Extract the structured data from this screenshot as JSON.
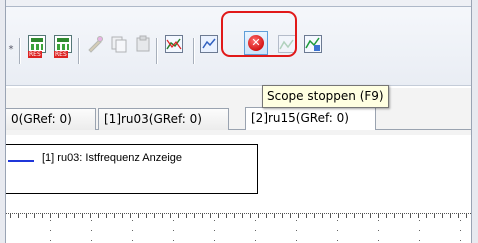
{
  "toolbar": {
    "stop_button": {
      "label": "Scope stoppen (F9)"
    }
  },
  "tooltip": {
    "text": "Scope stoppen (F9)"
  },
  "tabs": [
    {
      "label": "0(GRef: 0)"
    },
    {
      "label": "[1]ru03(GRef: 0)"
    },
    {
      "label": "[2]ru15(GRef: 0)"
    }
  ],
  "legend": {
    "entries": [
      {
        "label": "[1] ru03: Istfrequenz Anzeige",
        "color": "#1f36d9"
      }
    ]
  },
  "colors": {
    "highlight": "#e11919",
    "tooltip_bg": "#ffffe1"
  }
}
